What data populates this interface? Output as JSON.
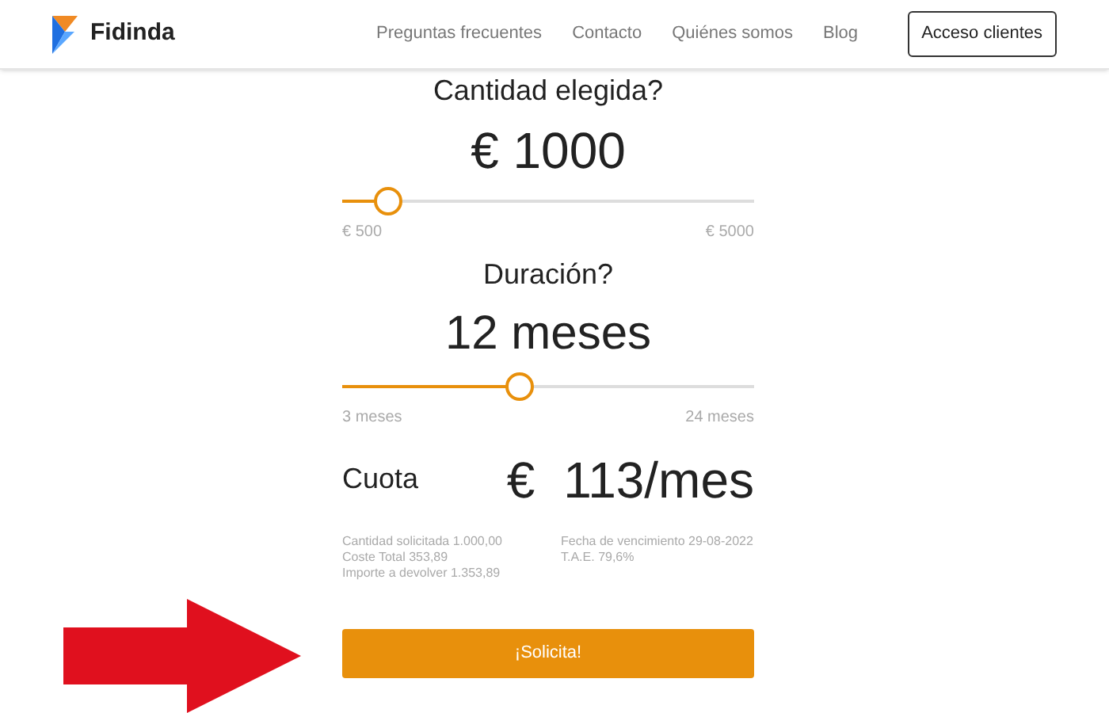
{
  "header": {
    "brand": "Fidinda",
    "nav": [
      "Preguntas frecuentes",
      "Contacto",
      "Quiénes somos",
      "Blog"
    ],
    "login_button": "Acceso clientes"
  },
  "amount": {
    "question": "Cantidad elegida?",
    "value": "€ 1000",
    "level": 0.11,
    "min": "€ 500",
    "max": "€ 5000"
  },
  "duration": {
    "question": "Duración?",
    "value": "12 meses",
    "level": 0.43,
    "min": "3 meses",
    "max": "24 meses"
  },
  "fee": {
    "label": "Cuota",
    "currency": "€",
    "value": "113/mes"
  },
  "details_left": [
    "Cantidad solicitada 1.000,00",
    "Coste Total 353,89",
    "Importe a devolver 1.353,89"
  ],
  "details_right": [
    "Fecha de vencimiento 29-08-2022",
    "T.A.E. 79,6%"
  ],
  "submit_button": "¡Solicita!"
}
